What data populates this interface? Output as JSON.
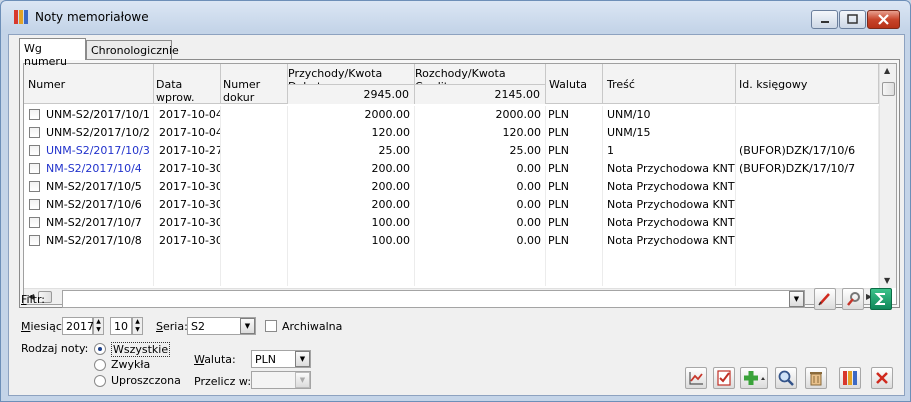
{
  "window": {
    "title": "Noty memoriałowe",
    "controls": {
      "minimize": "minimize",
      "maximize": "maximize",
      "close": "close"
    }
  },
  "tabs": [
    {
      "label": "Wg numeru",
      "active": true
    },
    {
      "label": "Chronologicznie",
      "active": false
    }
  ],
  "grid": {
    "columns": [
      "Numer",
      "Data wprow.",
      "Numer dokur",
      "Przychody/Kwota Debet",
      "Rozchody/Kwota Credit",
      "Waluta",
      "Treść",
      "Id. księgowy"
    ],
    "totals": {
      "debet": "2945.00",
      "credit": "2145.00"
    },
    "rows": [
      {
        "numer": "UNM-S2/2017/10/1",
        "data": "2017-10-04",
        "numer_dok": "",
        "debet": "2000.00",
        "credit": "2000.00",
        "waluta": "PLN",
        "tresc": "UNM/10",
        "id_ksieg": "",
        "color": "#000000"
      },
      {
        "numer": "UNM-S2/2017/10/2",
        "data": "2017-10-04",
        "numer_dok": "",
        "debet": "120.00",
        "credit": "120.00",
        "waluta": "PLN",
        "tresc": "UNM/15",
        "id_ksieg": "",
        "color": "#000000"
      },
      {
        "numer": "UNM-S2/2017/10/3",
        "data": "2017-10-27",
        "numer_dok": "",
        "debet": "25.00",
        "credit": "25.00",
        "waluta": "PLN",
        "tresc": "1",
        "id_ksieg": "(BUFOR)DZK/17/10/6",
        "color": "#2233cc"
      },
      {
        "numer": "NM-S2/2017/10/4",
        "data": "2017-10-30",
        "numer_dok": "",
        "debet": "200.00",
        "credit": "0.00",
        "waluta": "PLN",
        "tresc": "Nota Przychodowa KNT",
        "id_ksieg": "(BUFOR)DZK/17/10/7",
        "color": "#2233cc"
      },
      {
        "numer": "NM-S2/2017/10/5",
        "data": "2017-10-30",
        "numer_dok": "",
        "debet": "200.00",
        "credit": "0.00",
        "waluta": "PLN",
        "tresc": "Nota Przychodowa KNT",
        "id_ksieg": "",
        "color": "#000000"
      },
      {
        "numer": "NM-S2/2017/10/6",
        "data": "2017-10-30",
        "numer_dok": "",
        "debet": "200.00",
        "credit": "0.00",
        "waluta": "PLN",
        "tresc": "Nota Przychodowa KNT",
        "id_ksieg": "",
        "color": "#000000"
      },
      {
        "numer": "NM-S2/2017/10/7",
        "data": "2017-10-30",
        "numer_dok": "",
        "debet": "100.00",
        "credit": "0.00",
        "waluta": "PLN",
        "tresc": "Nota Przychodowa KNT",
        "id_ksieg": "",
        "color": "#000000"
      },
      {
        "numer": "NM-S2/2017/10/8",
        "data": "2017-10-30",
        "numer_dok": "",
        "debet": "100.00",
        "credit": "0.00",
        "waluta": "PLN",
        "tresc": "Nota Przychodowa KNT",
        "id_ksieg": "",
        "color": "#000000"
      }
    ]
  },
  "filter": {
    "label": "Filtr:",
    "value": ""
  },
  "miesiac": {
    "label": "Miesiąc:",
    "year": "2017",
    "month": "10"
  },
  "seria": {
    "label": "Seria:",
    "value": "S2"
  },
  "archiwalna": {
    "label": "Archiwalna",
    "checked": false
  },
  "rodzaj": {
    "label": "Rodzaj noty:",
    "options": [
      {
        "label": "Wszystkie",
        "selected": true
      },
      {
        "label": "Zwykła",
        "selected": false
      },
      {
        "label": "Uproszczona",
        "selected": false
      }
    ]
  },
  "waluta": {
    "label": "Waluta:",
    "value": "PLN"
  },
  "przelicz": {
    "label": "Przelicz w:",
    "value": ""
  },
  "toolbar": [
    "chart-icon",
    "document-check-icon",
    "add-icon",
    "search-icon",
    "trash-icon",
    "books-icon",
    "close-icon"
  ]
}
